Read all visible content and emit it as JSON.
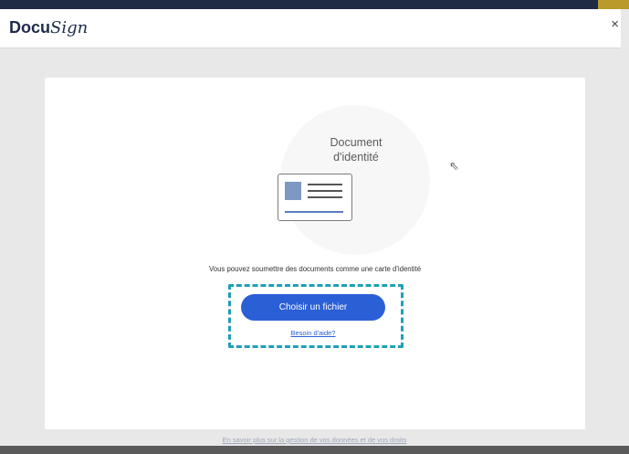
{
  "app": {
    "logo_part1": "Docu",
    "logo_part2": "Sign",
    "close_label": "×"
  },
  "document": {
    "title": "Document\nd'identité",
    "icon": "id-card-icon"
  },
  "description": "Vous pouvez soumettre des documents comme une carte d'identité",
  "actions": {
    "choose_file_label": "Choisir un fichier",
    "help_label": "Besoin d'aide?"
  },
  "footer": {
    "link_label": "En savoir plus sur la gestion de vos données et de vos droits"
  },
  "colors": {
    "primary_button": "#2b5fd6",
    "highlight_border": "#1f9fb9",
    "logo": "#1e2b4a"
  }
}
